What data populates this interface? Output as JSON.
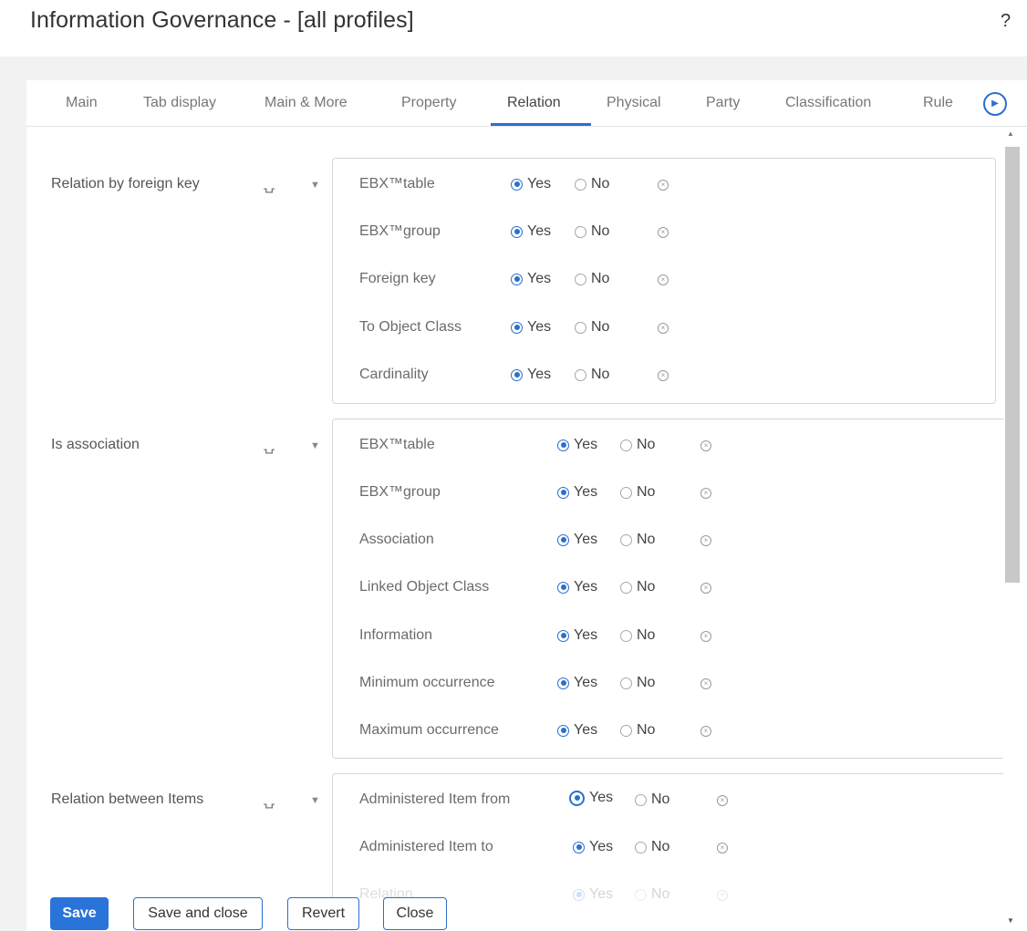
{
  "title": "Information Governance - [all profiles]",
  "help": "?",
  "tabs": [
    "Main",
    "Tab display",
    "Main & More",
    "Property",
    "Relation",
    "Physical",
    "Party",
    "Classification",
    "Rule"
  ],
  "active_tab": "Relation",
  "colors": {
    "accent": "#2a6fcf",
    "primary_button": "#2a73d9"
  },
  "options": {
    "yes": "Yes",
    "no": "No"
  },
  "sections": [
    {
      "label": "Relation by foreign key",
      "fields": [
        "EBX™table",
        "EBX™group",
        "Foreign key",
        "To Object Class",
        "Cardinality"
      ],
      "selected": [
        "Yes",
        "Yes",
        "Yes",
        "Yes",
        "Yes"
      ]
    },
    {
      "label": "Is association",
      "fields": [
        "EBX™table",
        "EBX™group",
        "Association",
        "Linked Object Class",
        "Information",
        "Minimum occurrence",
        "Maximum occurrence"
      ],
      "selected": [
        "Yes",
        "Yes",
        "Yes",
        "Yes",
        "Yes",
        "Yes",
        "Yes"
      ]
    },
    {
      "label": "Relation between Items",
      "fields": [
        "Administered Item from",
        "Administered Item to",
        "Relation"
      ],
      "selected": [
        "Yes",
        "Yes",
        "Yes"
      ]
    }
  ],
  "buttons": {
    "save": "Save",
    "save_close": "Save and close",
    "revert": "Revert",
    "close": "Close"
  },
  "icons": {
    "permission": "headset-lock-icon",
    "expand": "caret-down-icon",
    "clear": "clear-circle-icon",
    "next_tab": "chevron-right-circle-icon"
  }
}
